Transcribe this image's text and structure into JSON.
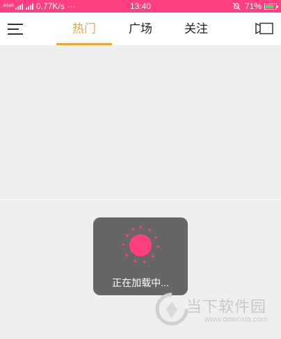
{
  "status_bar": {
    "network_label": "4G4G",
    "speed": "0.77K/s",
    "dots": "···",
    "time": "13:40",
    "battery_percent": "71%",
    "battery_level": 0.71,
    "background_color": "#ff3f7f"
  },
  "nav": {
    "menu_icon": "menu-icon",
    "tabs": [
      {
        "label": "热门",
        "active": true
      },
      {
        "label": "广场",
        "active": false
      },
      {
        "label": "关注",
        "active": false
      }
    ],
    "active_color": "#e8a735",
    "camera_icon": "camera-icon"
  },
  "loading": {
    "text": "正在加载中...",
    "spinner_color": "#ff3f7f"
  },
  "watermark": {
    "title": "当下软件园",
    "url": "www.downxia.com"
  }
}
